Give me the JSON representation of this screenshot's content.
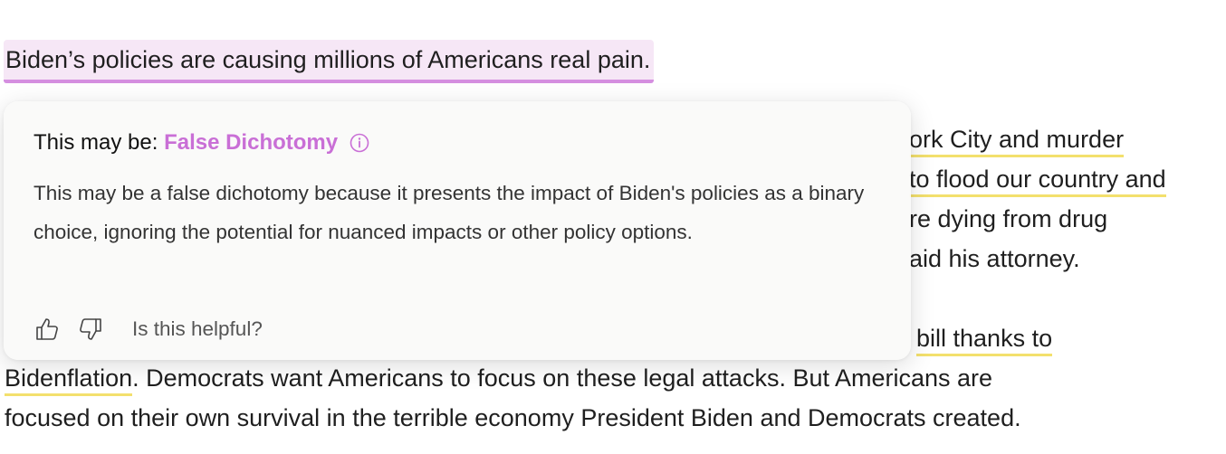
{
  "article": {
    "flagged_sentence": "Biden’s policies are causing millions of Americans real pain.",
    "para2_line1_fragment": "ork City and murder",
    "para2_line2_fragment": "to flood our country and",
    "para2_line3_fragment": "re dying from drug",
    "para2_line4_fragment": "aid his attorney.",
    "para3_line1_fragment": "bill thanks to",
    "para3_line2_underlined": "Bidenflation",
    "para3_line2_rest": ". Democrats want Americans to focus on these legal attacks. But Americans are",
    "para3_line3": "focused on their own survival in the terrible economy President Biden and Democrats created."
  },
  "popover": {
    "prefix": "This may be:",
    "fallacy_name": "False Dichotomy",
    "info_icon": "info-icon",
    "explanation": "This may be a false dichotomy because it presents the impact of Biden's policies as a binary choice, ignoring the potential for nuanced impacts or other policy options.",
    "feedback_prompt": "Is this helpful?",
    "thumbs_up_icon": "thumbs-up-icon",
    "thumbs_down_icon": "thumbs-down-icon"
  },
  "colors": {
    "flag_highlight_bg": "#f6e7f6",
    "flag_underline": "#d58fe0",
    "fallacy_accent": "#c96fd6",
    "secondary_underline": "#f3e06d"
  }
}
